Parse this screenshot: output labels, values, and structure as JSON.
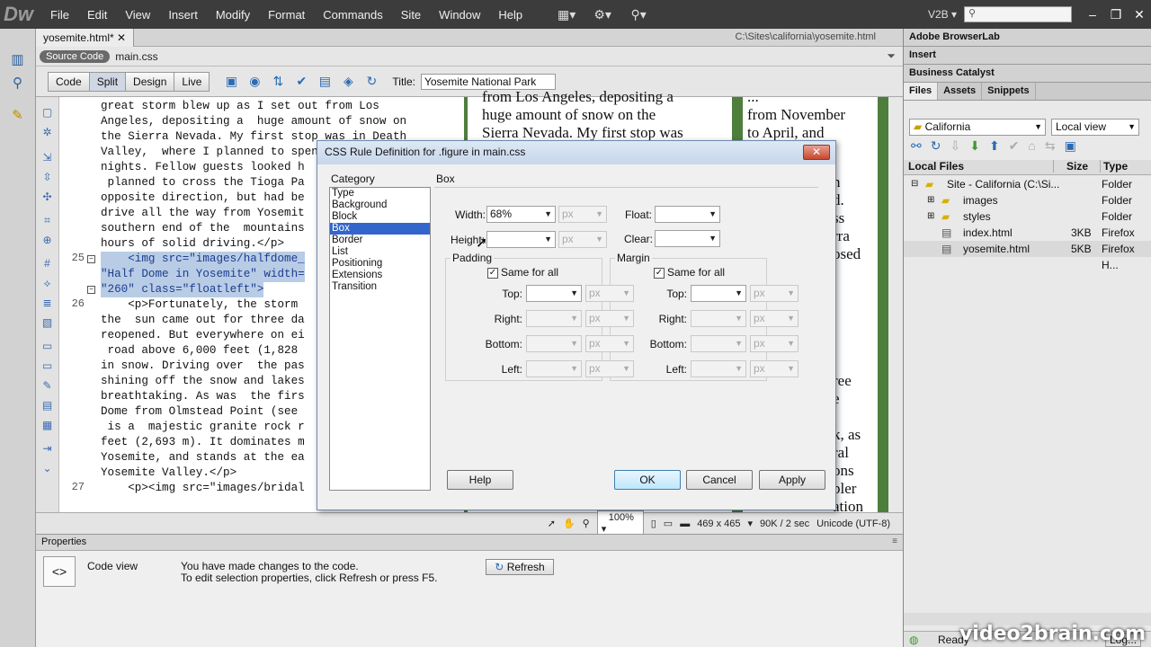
{
  "app": {
    "logo": "Dw",
    "menu": [
      "File",
      "Edit",
      "View",
      "Insert",
      "Modify",
      "Format",
      "Commands",
      "Site",
      "Window",
      "Help"
    ],
    "workspace": "V2B"
  },
  "doc": {
    "tab": "yosemite.html*",
    "path": "C:\\Sites\\california\\yosemite.html",
    "source_pill": "Source Code",
    "related_file": "main.css",
    "views": [
      "Code",
      "Split",
      "Design",
      "Live"
    ],
    "title_label": "Title:",
    "title_value": "Yosemite National Park"
  },
  "code_lines": [
    {
      "n": "",
      "t": "great storm blew up as I set out from Los"
    },
    {
      "n": "",
      "t": "Angeles, depositing a  huge amount of snow on"
    },
    {
      "n": "",
      "t": "the Sierra Nevada. My first stop was in Death"
    },
    {
      "n": "",
      "t": "Valley,  where I planned to spend a couple of"
    },
    {
      "n": "",
      "t": "nights. Fellow guests looked h"
    },
    {
      "n": "",
      "t": " planned to cross the Tioga Pa"
    },
    {
      "n": "",
      "t": "opposite direction, but had be"
    },
    {
      "n": "",
      "t": "drive all the way from Yosemit"
    },
    {
      "n": "",
      "t": "southern end of the  mountains"
    },
    {
      "n": "",
      "t": "hours of solid driving.</p>"
    },
    {
      "n": "25",
      "t": "    <img src=\"images/halfdome_"
    },
    {
      "n": "",
      "t": "\"Half Dome in Yosemite\" width="
    },
    {
      "n": "",
      "t": "\"260\" class=\"floatleft\">"
    },
    {
      "n": "26",
      "t": "    <p>Fortunately, the storm"
    },
    {
      "n": "",
      "t": "the  sun came out for three da"
    },
    {
      "n": "",
      "t": "reopened. But everywhere on ei"
    },
    {
      "n": "",
      "t": " road above 6,000 feet (1,828"
    },
    {
      "n": "",
      "t": "in snow. Driving over  the pas"
    },
    {
      "n": "",
      "t": "shining off the snow and lakes"
    },
    {
      "n": "",
      "t": "breathtaking. As was  the firs"
    },
    {
      "n": "",
      "t": "Dome from Olmstead Point (see"
    },
    {
      "n": "",
      "t": " is a  majestic granite rock r"
    },
    {
      "n": "",
      "t": "feet (2,693 m). It dominates m"
    },
    {
      "n": "",
      "t": "Yosemite, and stands at the ea"
    },
    {
      "n": "",
      "t": "Yosemite Valley.</p>"
    },
    {
      "n": "27",
      "t": "    <p><img src=\"images/bridal"
    }
  ],
  "design_text": {
    "col1": [
      "from Los Angeles, depositing a",
      "huge amount of snow on the",
      "Sierra Nevada. My first stop was"
    ],
    "col2": [
      "...",
      "from November",
      "to April, and"
    ],
    "col2_frag": [
      "n",
      "d.",
      "ss",
      "rra",
      "osed"
    ],
    "col2_frag2": [
      "ree",
      "e",
      "",
      "k, as",
      "ral",
      "ons",
      "pler",
      "ation"
    ]
  },
  "status": {
    "zoom": "100%",
    "size": "469 x 465",
    "weight": "90K / 2 sec",
    "encoding": "Unicode (UTF-8)"
  },
  "properties": {
    "header": "Properties",
    "mode": "Code view",
    "msg1": "You have made changes to the code.",
    "msg2": "To edit selection properties, click Refresh or press F5.",
    "refresh": "Refresh"
  },
  "panels": {
    "browserlab": "Adobe BrowserLab",
    "insert": "Insert",
    "catalyst": "Business Catalyst",
    "tabs": [
      "Files",
      "Assets",
      "Snippets"
    ],
    "site": "California",
    "view": "Local view",
    "cols": [
      "Local Files",
      "Size",
      "Type"
    ],
    "files": [
      {
        "name": "Site - California (C:\\Si...",
        "size": "",
        "type": "Folder",
        "indent": 0,
        "kind": "folder"
      },
      {
        "name": "images",
        "size": "",
        "type": "Folder",
        "indent": 1,
        "kind": "folder"
      },
      {
        "name": "styles",
        "size": "",
        "type": "Folder",
        "indent": 1,
        "kind": "folder"
      },
      {
        "name": "index.html",
        "size": "3KB",
        "type": "Firefox H...",
        "indent": 1,
        "kind": "file"
      },
      {
        "name": "yosemite.html",
        "size": "5KB",
        "type": "Firefox H...",
        "indent": 1,
        "kind": "file"
      }
    ],
    "ready": "Ready",
    "log": "Log..."
  },
  "dialog": {
    "title": "CSS Rule Definition for .figure in main.css",
    "category_label": "Category",
    "section": "Box",
    "categories": [
      "Type",
      "Background",
      "Block",
      "Box",
      "Border",
      "List",
      "Positioning",
      "Extensions",
      "Transition"
    ],
    "selected": "Box",
    "width_label": "Width:",
    "width_value": "68%",
    "height_label": "Height:",
    "unit": "px",
    "float_label": "Float:",
    "clear_label": "Clear:",
    "padding": "Padding",
    "margin": "Margin",
    "same_for_all": "Same for all",
    "sides": [
      "Top:",
      "Right:",
      "Bottom:",
      "Left:"
    ],
    "buttons": {
      "help": "Help",
      "ok": "OK",
      "cancel": "Cancel",
      "apply": "Apply"
    }
  },
  "watermark": "video2brain.com"
}
